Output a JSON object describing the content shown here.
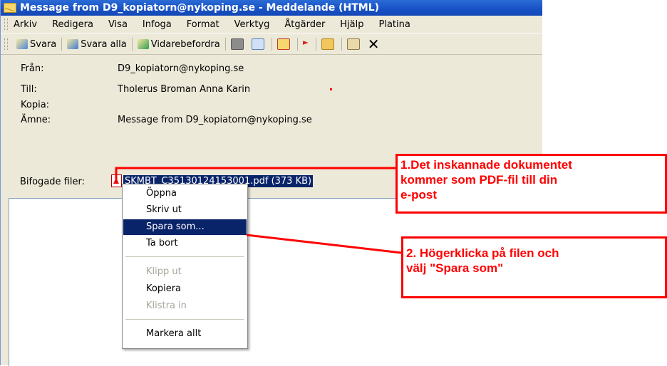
{
  "window": {
    "title": "Message from D9_kopiatorn@nykoping.se - Meddelande (HTML)"
  },
  "menubar": {
    "items": [
      "Arkiv",
      "Redigera",
      "Visa",
      "Infoga",
      "Format",
      "Verktyg",
      "Åtgärder",
      "Hjälp",
      "Platina"
    ]
  },
  "toolbar": {
    "reply": "Svara",
    "reply_all": "Svara alla",
    "forward": "Vidarebefordra"
  },
  "header": {
    "from_label": "Från:",
    "from_value": "D9_kopiatorn@nykoping.se",
    "to_label": "Till:",
    "to_value": "Tholerus Broman Anna Karin",
    "cc_label": "Kopia:",
    "subject_label": "Ämne:",
    "subject_value": "Message from D9_kopiatorn@nykoping.se",
    "attachments_label": "Bifogade filer:",
    "attachment_file": "SKMBT_C35130124153001.pdf (373 KB)"
  },
  "context_menu": {
    "open": "Öppna",
    "print": "Skriv ut",
    "save_as": "Spara som...",
    "remove": "Ta bort",
    "cut": "Klipp ut",
    "copy": "Kopiera",
    "paste": "Klistra in",
    "select_all": "Markera allt"
  },
  "callouts": {
    "step1_line1": "1.Det inskannade dokumentet",
    "step1_line2": "kommer som PDF-fil till din",
    "step1_line3": "e-post",
    "step2_line1": "2. Högerklicka på filen och",
    "step2_line2": "välj \"Spara som\""
  },
  "colors": {
    "titlebar": "#1751c4",
    "highlight": "#0a246a",
    "callout_red": "#ff0000",
    "chrome": "#ece9d8"
  }
}
